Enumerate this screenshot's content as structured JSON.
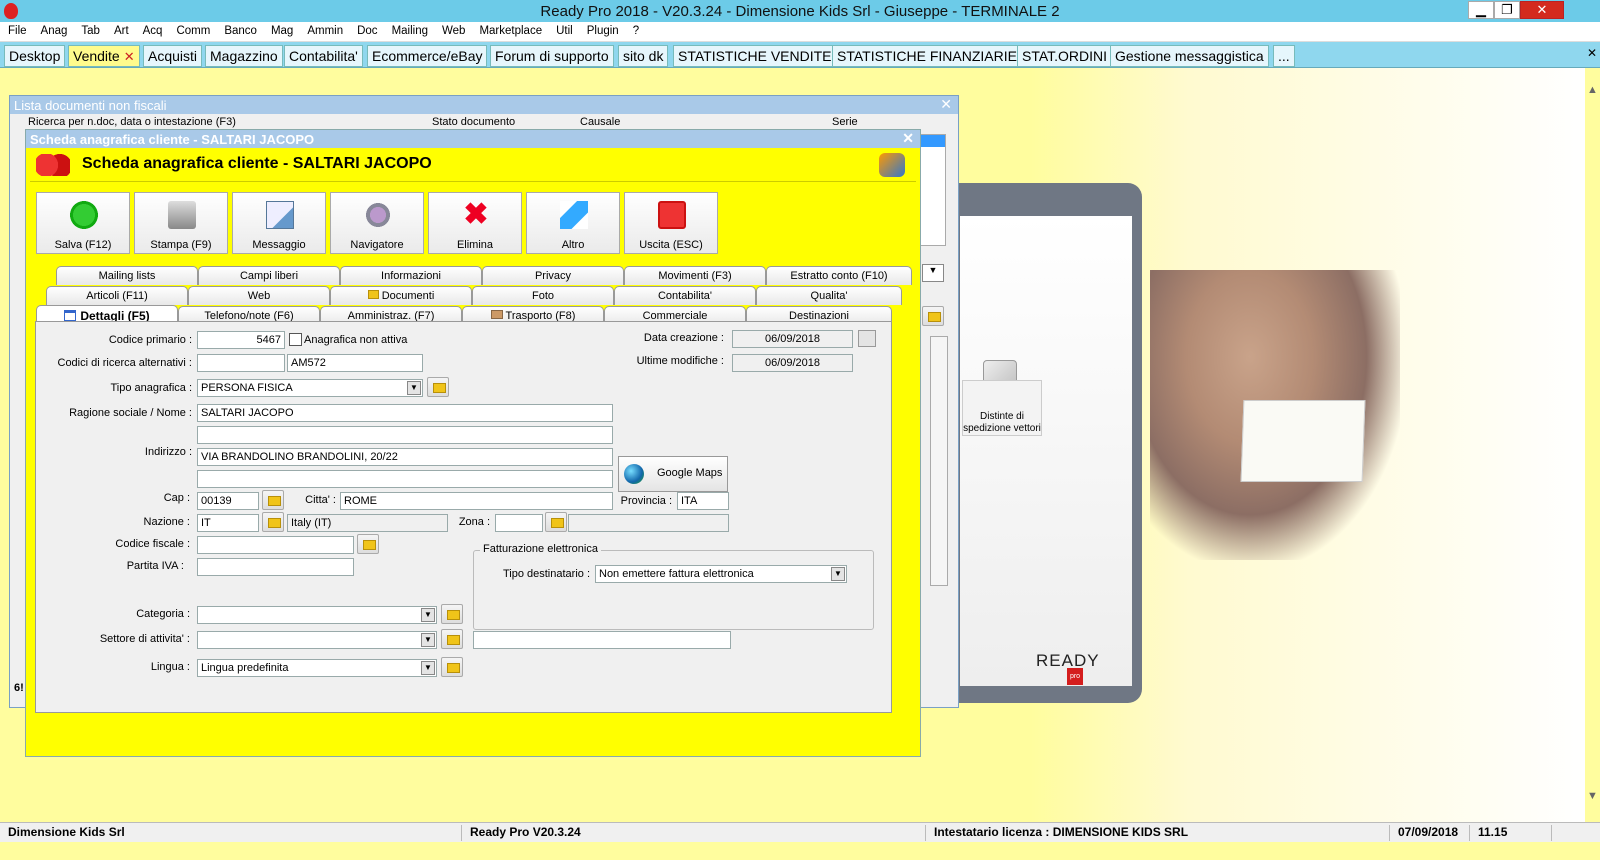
{
  "window": {
    "title": "Ready Pro 2018 - V20.3.24 - Dimensione Kids Srl - Giuseppe - TERMINALE 2",
    "min": "▁",
    "restore": "❐",
    "close": "✕"
  },
  "menu": [
    "File",
    "Anag",
    "Tab",
    "Art",
    "Acq",
    "Comm",
    "Banco",
    "Mag",
    "Ammin",
    "Doc",
    "Mailing",
    "Web",
    "Marketplace",
    "Util",
    "Plugin",
    "?"
  ],
  "tabs": [
    "Desktop",
    "Vendite",
    "Acquisti",
    "Magazzino",
    "Contabilita'",
    "Ecommerce/eBay",
    "Forum di supporto",
    "sito dk",
    "STATISTICHE VENDITE",
    "STATISTICHE FINANZIARIE",
    "STAT.ORDINI",
    "Gestione messaggistica",
    "..."
  ],
  "tab_close": "✕",
  "lista": {
    "title": "Lista documenti non fiscali",
    "search_label": "Ricerca per n.doc, data o intestazione (F3)",
    "stato_label": "Stato documento",
    "causale_label": "Causale",
    "serie_label": "Serie",
    "count_fragment": "6!"
  },
  "scheda": {
    "window_title": "Scheda anagrafica cliente - SALTARI JACOPO",
    "title": "Scheda anagrafica cliente - SALTARI JACOPO",
    "toolbar": [
      "Salva (F12)",
      "Stampa (F9)",
      "Messaggio",
      "Navigatore",
      "Elimina",
      "Altro",
      "Uscita (ESC)"
    ],
    "tabs_row1": [
      "Mailing lists",
      "Campi liberi",
      "Informazioni",
      "Privacy",
      "Movimenti (F3)",
      "Estratto conto (F10)"
    ],
    "tabs_row2": [
      "Articoli (F11)",
      "Web",
      "Documenti",
      "Foto",
      "Contabilita'",
      "Qualita'"
    ],
    "tabs_row3": [
      "Dettagli (F5)",
      "Telefono/note (F6)",
      "Amministraz. (F7)",
      "Trasporto (F8)",
      "Commerciale",
      "Destinazioni"
    ],
    "labels": {
      "codice_primario": "Codice primario :",
      "codici_ricerca": "Codici di ricerca alternativi :",
      "tipo_anagrafica": "Tipo anagrafica :",
      "ragione_sociale": "Ragione sociale / Nome :",
      "indirizzo": "Indirizzo :",
      "cap": "Cap :",
      "citta": "Citta' :",
      "provincia": "Provincia :",
      "nazione": "Nazione :",
      "zona": "Zona :",
      "codice_fiscale": "Codice fiscale :",
      "partita_iva": "Partita IVA :",
      "categoria": "Categoria :",
      "settore": "Settore di attivita' :",
      "lingua": "Lingua :",
      "data_creazione": "Data creazione :",
      "ultime_modifiche": "Ultime modifiche :",
      "anagrafica_non_attiva": "Anagrafica non attiva",
      "fatturazione": "Fatturazione elettronica",
      "tipo_destinatario": "Tipo destinatario :"
    },
    "values": {
      "codice_primario": "5467",
      "codice_alt2": "AM572",
      "tipo_anagrafica": "PERSONA FISICA",
      "ragione_sociale": "SALTARI JACOPO",
      "indirizzo": "VIA BRANDOLINO BRANDOLINI, 20/22",
      "cap": "00139",
      "citta": "ROME",
      "provincia": "ITA",
      "nazione": "IT",
      "nazione_desc": "Italy (IT)",
      "lingua": "Lingua predefinita",
      "data_creazione": "06/09/2018",
      "ultime_modifiche": "06/09/2018",
      "tipo_destinatario": "Non emettere fattura elettronica"
    },
    "google_maps": "Google Maps"
  },
  "desktop": {
    "distinte_label": "Distinte di spedizione vettori",
    "logo": "READY",
    "logo_sub": "pro"
  },
  "status": {
    "company": "Dimensione Kids Srl",
    "version": "Ready Pro V20.3.24",
    "license": "Intestatario licenza : DIMENSIONE KIDS SRL",
    "date": "07/09/2018",
    "time": "11.15"
  }
}
